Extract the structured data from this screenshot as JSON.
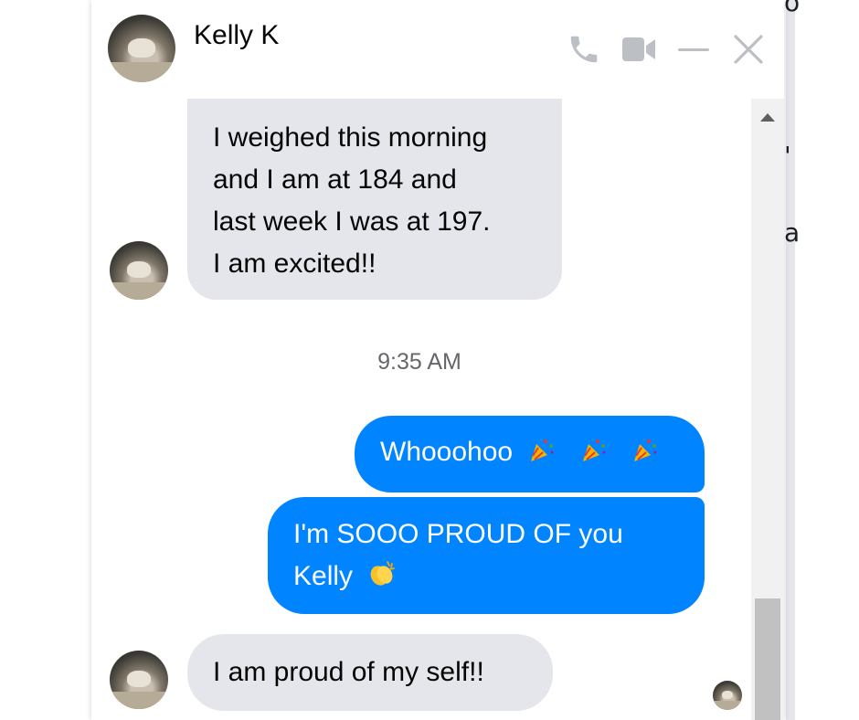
{
  "contact": {
    "name": "Kelly K"
  },
  "header_icons": [
    "phone-icon",
    "video-camera-icon",
    "minimize-icon",
    "close-icon"
  ],
  "messages": [
    {
      "from": "contact",
      "lines": [
        "I weighed this morning",
        "and I am at 184 and",
        "last week I was at 197.",
        "I am excited!!"
      ]
    },
    {
      "type": "timestamp",
      "text": "9:35 AM"
    },
    {
      "from": "me",
      "text": "Whooohoo",
      "emoji": [
        "party-popper-icon",
        "party-popper-icon",
        "party-popper-icon"
      ]
    },
    {
      "from": "me",
      "lines": [
        "I'm SOOO PROUD OF you",
        "Kelly"
      ],
      "emoji": [
        "clapping-hands-icon"
      ]
    },
    {
      "from": "contact",
      "text": "I am proud of my self!!"
    }
  ],
  "background_fragments": [
    "'",
    "a",
    "o"
  ],
  "colors": {
    "outgoing": "#0084ff",
    "incoming": "#e4e6eb",
    "timestamp": "#65676b"
  }
}
